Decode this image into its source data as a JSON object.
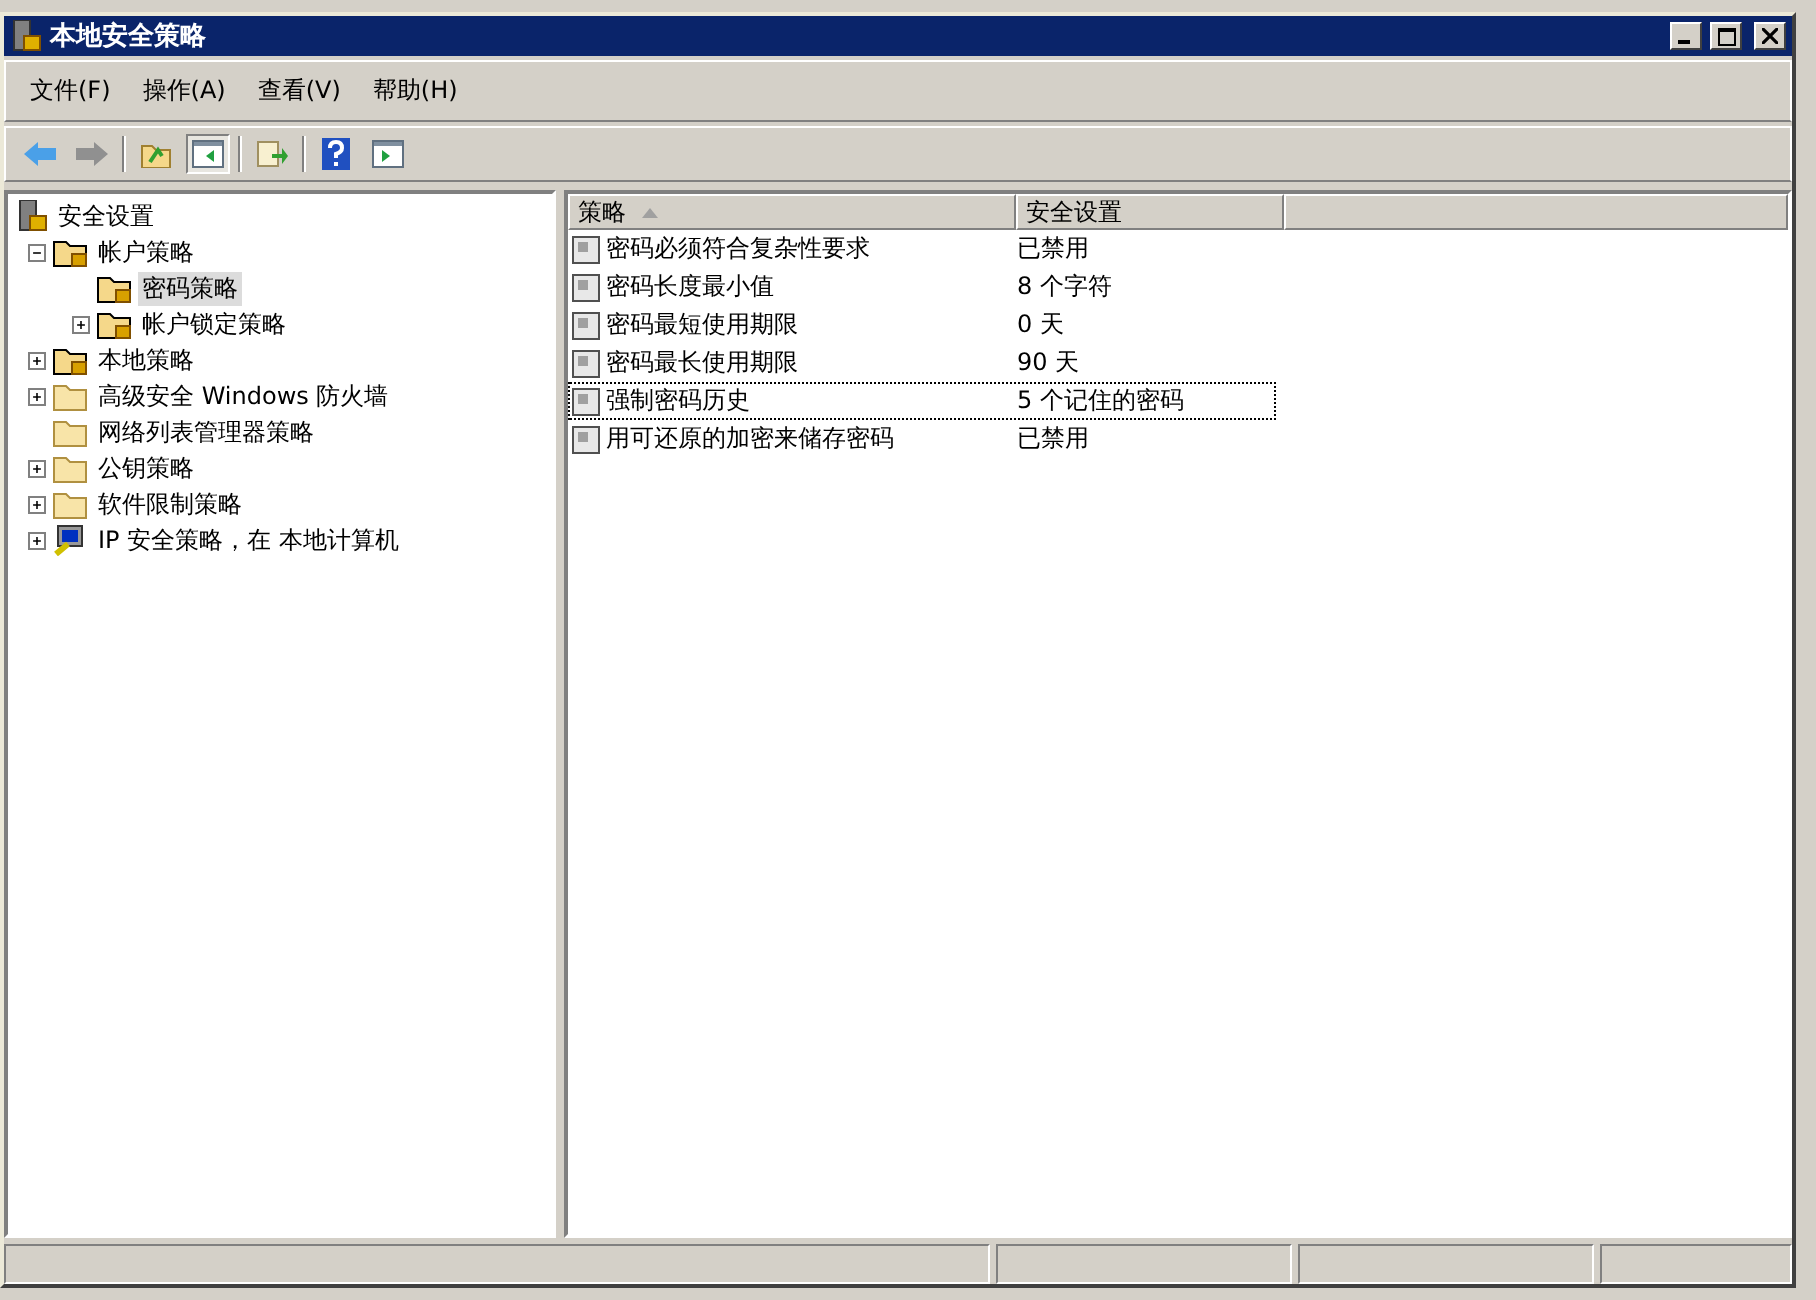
{
  "window": {
    "title": "本地安全策略"
  },
  "menu": [
    "文件(F)",
    "操作(A)",
    "查看(V)",
    "帮助(H)"
  ],
  "tree": [
    {
      "label": "安全设置",
      "kind": "root",
      "selected": false,
      "children": [
        {
          "label": "帐户策略",
          "kind": "lock-folder",
          "expanded": true,
          "selected": false,
          "children": [
            {
              "label": "密码策略",
              "kind": "lock-folder",
              "selected": true
            },
            {
              "label": "帐户锁定策略",
              "kind": "lock-folder",
              "expanded": false,
              "selected": false
            }
          ]
        },
        {
          "label": "本地策略",
          "kind": "lock-folder",
          "expanded": false,
          "selected": false
        },
        {
          "label": "高级安全 Windows 防火墙",
          "kind": "folder",
          "expanded": false,
          "selected": false
        },
        {
          "label": "网络列表管理器策略",
          "kind": "folder",
          "selected": false
        },
        {
          "label": "公钥策略",
          "kind": "folder",
          "expanded": false,
          "selected": false
        },
        {
          "label": "软件限制策略",
          "kind": "folder",
          "expanded": false,
          "selected": false
        },
        {
          "label": "IP 安全策略，在 本地计算机",
          "kind": "computer",
          "expanded": false,
          "selected": false
        }
      ]
    }
  ],
  "table": {
    "columns": [
      "策略",
      "安全设置"
    ],
    "rows": [
      {
        "policy": "密码必须符合复杂性要求",
        "setting": "已禁用",
        "focused": false
      },
      {
        "policy": "密码长度最小值",
        "setting": "8 个字符",
        "focused": false
      },
      {
        "policy": "密码最短使用期限",
        "setting": "0 天",
        "focused": false
      },
      {
        "policy": "密码最长使用期限",
        "setting": "90 天",
        "focused": false
      },
      {
        "policy": "强制密码历史",
        "setting": "5 个记住的密码",
        "focused": true
      },
      {
        "policy": "用可还原的加密来储存密码",
        "setting": "已禁用",
        "focused": false
      }
    ]
  }
}
